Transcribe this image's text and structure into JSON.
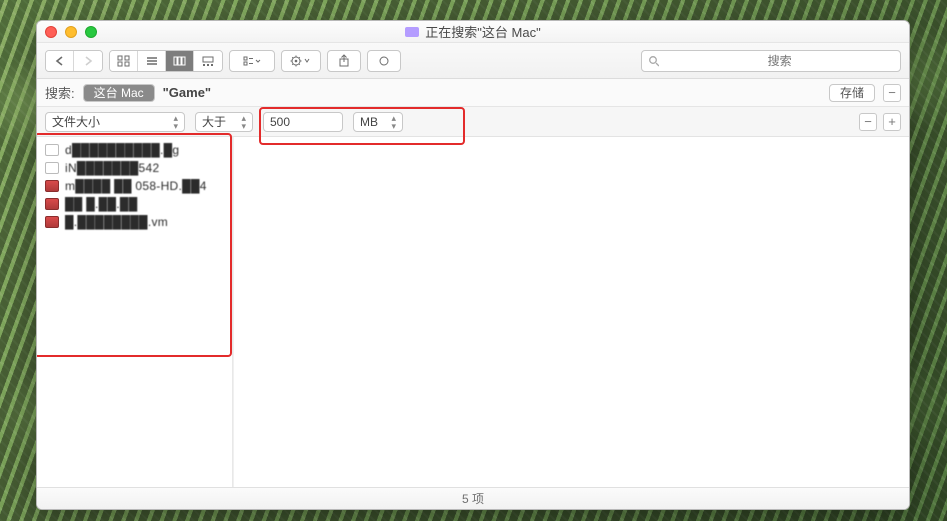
{
  "window": {
    "title": "正在搜索\"这台 Mac\""
  },
  "toolbar": {
    "search_placeholder": "搜索"
  },
  "scope": {
    "label": "搜索:",
    "selected": "这台 Mac",
    "other": "\"Game\"",
    "save_label": "存储"
  },
  "criteria": {
    "attr": "文件大小",
    "op": "大于",
    "value": "500",
    "unit": "MB"
  },
  "results": {
    "items": [
      {
        "icon": "doc",
        "name": "d██████████.█g"
      },
      {
        "icon": "doc",
        "name": "iN███████542"
      },
      {
        "icon": "img",
        "name": "m████ ██ 058-HD.██4"
      },
      {
        "icon": "img",
        "name": "██ █.██.██"
      },
      {
        "icon": "img",
        "name": "█.████████.vm"
      }
    ]
  },
  "status": {
    "text": "5 项"
  },
  "highlights": {
    "criteria_box": true,
    "results_box": true
  }
}
